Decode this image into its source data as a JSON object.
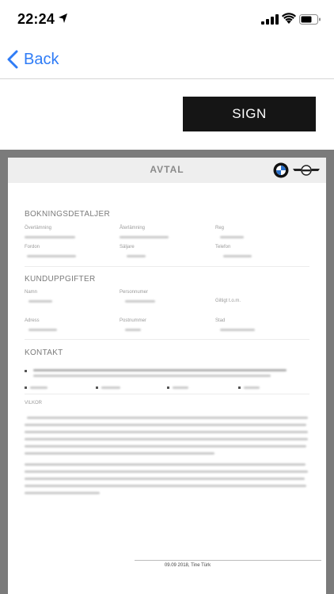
{
  "status_bar": {
    "time": "22:24"
  },
  "nav": {
    "back_label": "Back"
  },
  "actions": {
    "sign_label": "SIGN"
  },
  "document": {
    "title": "AVTAL",
    "sections": {
      "booking": {
        "title": "BOKNINGSDETALJER",
        "labels": [
          "Överlämning",
          "Återlämning",
          "Reg",
          "Fordon",
          "Säljare",
          "Telefon"
        ]
      },
      "customer": {
        "title": "KUNDUPPGIFTER",
        "labels": [
          "Namn",
          "Personnumer",
          "Giltigt t.o.m.",
          "Adress",
          "Postnummer",
          "Stad"
        ]
      },
      "contact": {
        "title": "KONTAKT"
      },
      "terms": {
        "title": "VILKOR"
      }
    },
    "footer": "09.09 2018, Tine Türk"
  },
  "colors": {
    "accent": "#2f7cf6",
    "button_bg": "#151515",
    "frame": "#7b7b7b"
  }
}
